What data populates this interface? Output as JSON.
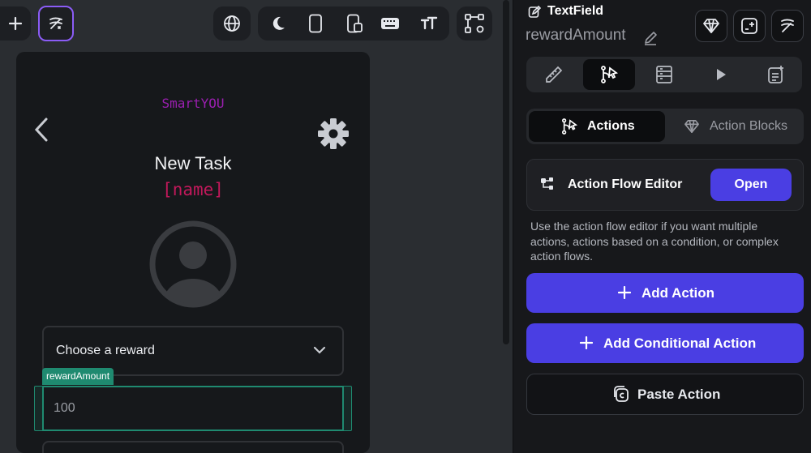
{
  "toolbar": {
    "add_icon": "plus-icon",
    "magic_icon": "magic-wand-icon",
    "globe_icon": "globe-icon",
    "dark_mode_icon": "moon-icon",
    "phone_icon": "phone-icon",
    "tablet_icon": "tablet-icon",
    "keyboard_icon": "keyboard-icon",
    "text_size_icon": "text-size-icon",
    "tree_icon": "widget-tree-icon",
    "accent": "#8b5cf6"
  },
  "phone": {
    "app_name": "SmartYOU",
    "title": "New Task",
    "name_placeholder": "[name]",
    "dropdown_label": "Choose a reward",
    "field_tag": "rewardAmount",
    "field_value": "100",
    "colors": {
      "brand": "#9b1fb0",
      "name": "#c2185b",
      "selection": "#1f8a70"
    }
  },
  "panel": {
    "widget_type": "TextField",
    "widget_name": "rewardAmount",
    "tabs": [
      "properties",
      "actions",
      "backend-query",
      "preview",
      "docs"
    ],
    "toggle": {
      "actions": "Actions",
      "action_blocks": "Action Blocks"
    },
    "flow_editor": {
      "label": "Action Flow Editor",
      "open": "Open"
    },
    "description": "Use the action flow editor if you want multiple actions, actions based on a condition, or complex action flows.",
    "add_action": "Add Action",
    "add_conditional": "Add Conditional Action",
    "paste_action": "Paste Action",
    "colors": {
      "primary": "#4a3ee3"
    }
  }
}
